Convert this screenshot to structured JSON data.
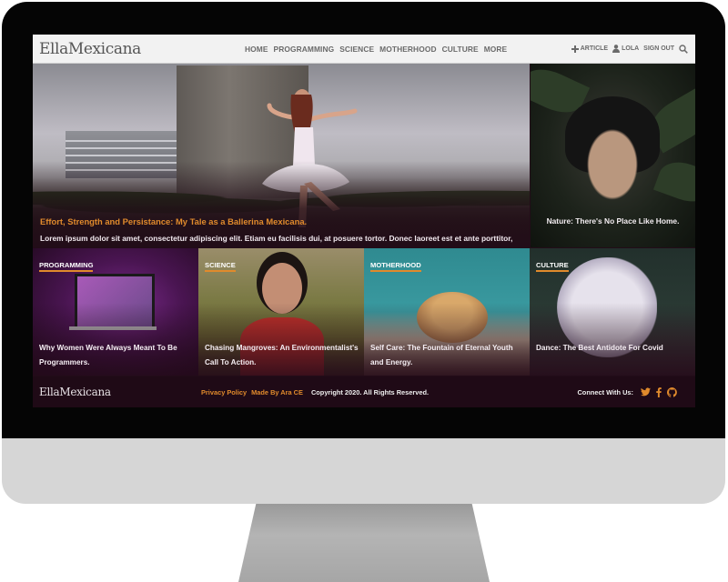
{
  "colors": {
    "accent": "#e08a2c",
    "dark_bg": "#220c18",
    "header_bg": "#f2f2f2",
    "nav_text": "#6a6a6a"
  },
  "header": {
    "logo": "EllaMexicana",
    "nav": [
      "HOME",
      "PROGRAMMING",
      "SCIENCE",
      "MOTHERHOOD",
      "CULTURE",
      "MORE"
    ],
    "user_nav": {
      "article": "ARTICLE",
      "article_icon": "plus-icon",
      "user": "LOLA",
      "user_icon": "user-icon",
      "signout": "SIGN OUT",
      "search_icon": "search-icon"
    }
  },
  "hero": {
    "title": "Effort, Strength and Persistance: My Tale as a Ballerina Mexicana.",
    "excerpt": "Lorem ipsum dolor sit amet, consectetur adipiscing elit. Etiam eu facilisis dui, at posuere tortor. Donec laoreet est et ante porttitor, non vestibulum ante fringilla. Aliquam vulputate sed enim ve..."
  },
  "side_card": {
    "title": "Nature: There's No Place Like Home."
  },
  "categories": [
    {
      "label": "PROGRAMMING",
      "title": "Why Women Were Always Meant To Be Programmers."
    },
    {
      "label": "SCIENCE",
      "title": "Chasing Mangroves: An Environmentalist's Call To Action."
    },
    {
      "label": "MOTHERHOOD",
      "title": "Self Care: The Fountain of Eternal Youth and Energy."
    },
    {
      "label": "CULTURE",
      "title": "Dance: The Best Antidote For Covid"
    }
  ],
  "footer": {
    "logo": "EllaMexicana",
    "privacy": "Privacy Policy",
    "made_by": "Made By Ara CE",
    "copyright": "Copyright 2020. All Rights Reserved.",
    "connect": "Connect With Us:",
    "social_icons": [
      "twitter-icon",
      "facebook-icon",
      "github-icon"
    ]
  }
}
